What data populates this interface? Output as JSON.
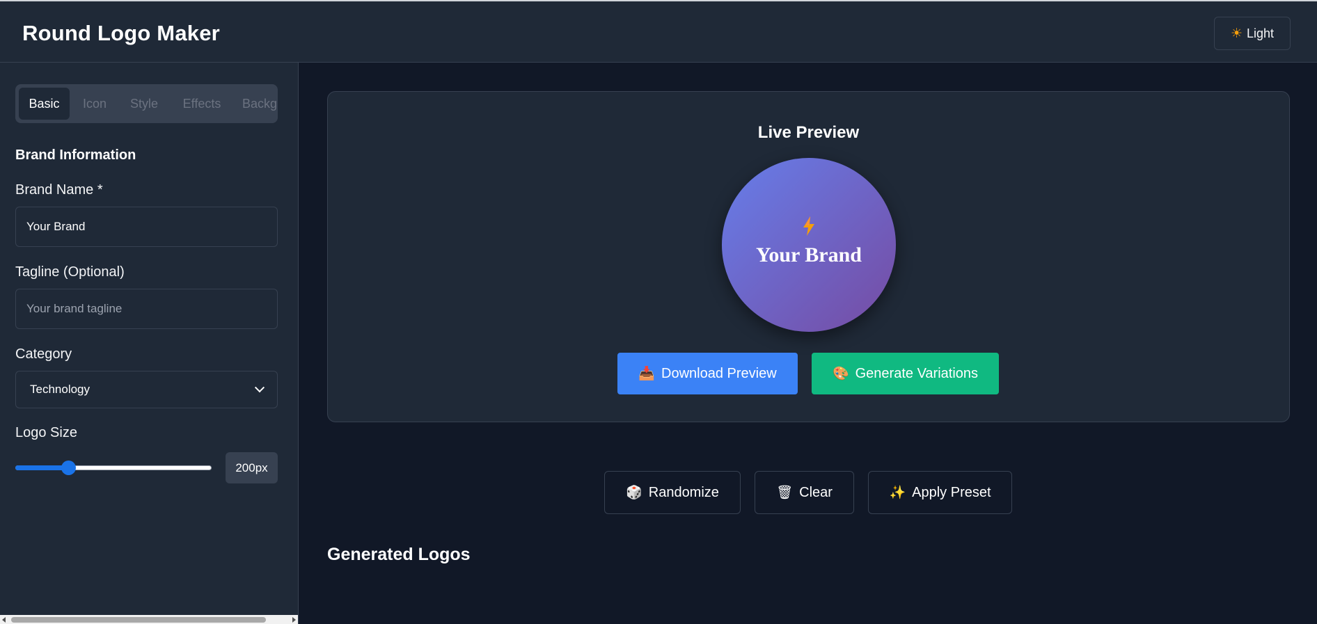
{
  "header": {
    "title": "Round Logo Maker",
    "theme_toggle_label": "Light",
    "theme_toggle_icon": "sun-icon"
  },
  "sidebar": {
    "tabs": [
      {
        "label": "Basic",
        "active": true
      },
      {
        "label": "Icon",
        "active": false
      },
      {
        "label": "Style",
        "active": false
      },
      {
        "label": "Effects",
        "active": false
      },
      {
        "label": "Background",
        "active": false
      }
    ],
    "section_title": "Brand Information",
    "brand_name": {
      "label": "Brand Name *",
      "value": "Your Brand"
    },
    "tagline": {
      "label": "Tagline (Optional)",
      "placeholder": "Your brand tagline",
      "value": ""
    },
    "category": {
      "label": "Category",
      "selected": "Technology"
    },
    "logo_size": {
      "label": "Logo Size",
      "value": 200,
      "min": 100,
      "max": 500,
      "display": "200px"
    }
  },
  "preview": {
    "title": "Live Preview",
    "logo_text": "Your Brand",
    "logo_icon": "lightning-icon",
    "gradient_start": "#667eea",
    "gradient_end": "#764ba2",
    "download_button": "Download Preview",
    "variations_button": "Generate Variations"
  },
  "actions": {
    "randomize": "Randomize",
    "clear": "Clear",
    "apply_preset": "Apply Preset"
  },
  "generated": {
    "title": "Generated Logos"
  },
  "colors": {
    "background": "#111827",
    "panel": "#1f2937",
    "border": "#374151",
    "primary": "#3b82f6",
    "success": "#10b981",
    "accent": "#f59e0b"
  }
}
